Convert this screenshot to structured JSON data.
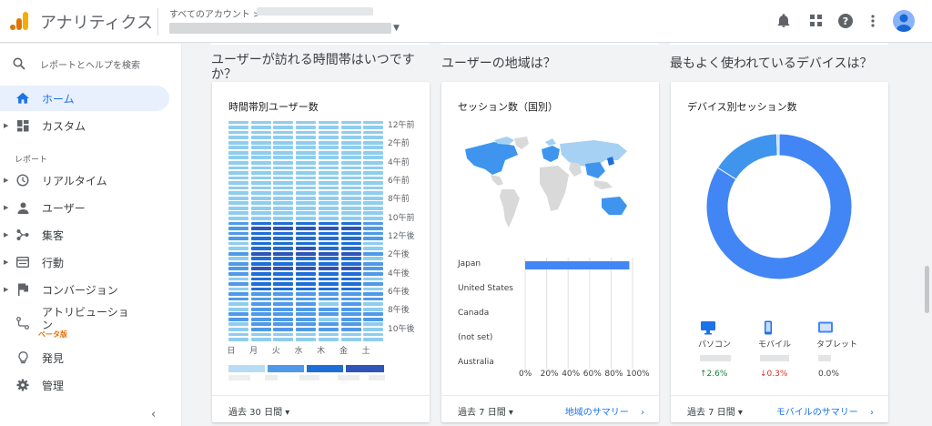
{
  "app": {
    "title": "アナリティクス",
    "breadcrumb": "すべてのアカウント >"
  },
  "colors": {
    "accent": "#1a73e8",
    "orange": "#f9ab00",
    "orange_dark": "#e37400",
    "green": "#188038",
    "red": "#d93025"
  },
  "sidebar": {
    "search_placeholder": "レポートとヘルプを検索",
    "home": "ホーム",
    "custom": "カスタム",
    "section": "レポート",
    "items": [
      {
        "label": "リアルタイム",
        "icon": "clock-icon"
      },
      {
        "label": "ユーザー",
        "icon": "person-icon"
      },
      {
        "label": "集客",
        "icon": "acquisition-icon"
      },
      {
        "label": "行動",
        "icon": "behavior-icon"
      },
      {
        "label": "コンバージョン",
        "icon": "flag-icon"
      }
    ],
    "attribution_line1": "アトリビューショ",
    "attribution_line2": "ン",
    "beta": "ベータ版",
    "discover": "発見",
    "admin": "管理"
  },
  "columns": {
    "time_title": "ユーザーが訪れる時間帯はいつです か？",
    "geo_title": "ユーザーの地域は？",
    "device_title": "最もよく使われているデバイスは？"
  },
  "time_card": {
    "title": "時間帯別ユーザー数",
    "hours": [
      "12午前",
      "2午前",
      "4午前",
      "6午前",
      "8午前",
      "10午前",
      "12午後",
      "2午後",
      "4午後",
      "6午後",
      "8午後",
      "10午後"
    ],
    "days": [
      "日",
      "月",
      "火",
      "水",
      "木",
      "金",
      "土"
    ],
    "period": "過去 30 日間",
    "levels": [
      [
        1,
        1,
        1,
        1,
        1,
        1,
        1
      ],
      [
        1,
        1,
        1,
        1,
        1,
        1,
        1
      ],
      [
        1,
        1,
        1,
        1,
        1,
        1,
        1
      ],
      [
        1,
        1,
        1,
        1,
        1,
        1,
        1
      ],
      [
        1,
        1,
        1,
        1,
        1,
        1,
        1
      ],
      [
        1,
        1,
        1,
        1,
        1,
        1,
        1
      ],
      [
        1,
        1,
        1,
        1,
        1,
        1,
        1
      ],
      [
        1,
        1,
        1,
        1,
        1,
        1,
        1
      ],
      [
        1,
        1,
        1,
        1,
        1,
        1,
        1
      ],
      [
        1,
        1,
        1,
        1,
        1,
        1,
        1
      ],
      [
        1,
        1,
        1,
        1,
        1,
        1,
        1
      ],
      [
        1,
        1,
        1,
        1,
        1,
        1,
        1
      ],
      [
        1,
        1,
        1,
        1,
        1,
        1,
        1
      ],
      [
        1,
        1,
        1,
        1,
        1,
        1,
        1
      ],
      [
        1,
        1,
        1,
        1,
        1,
        1,
        1
      ],
      [
        1,
        1,
        1,
        1,
        1,
        1,
        1
      ],
      [
        1,
        1,
        1,
        1,
        1,
        1,
        1
      ],
      [
        1,
        1,
        1,
        1,
        1,
        1,
        1
      ],
      [
        1,
        1,
        1,
        1,
        1,
        1,
        1
      ],
      [
        1,
        1,
        1,
        1,
        1,
        1,
        1
      ],
      [
        2,
        3,
        3,
        3,
        3,
        3,
        2
      ],
      [
        2,
        4,
        4,
        4,
        4,
        4,
        2
      ],
      [
        2,
        3,
        3,
        3,
        3,
        3,
        2
      ],
      [
        2,
        3,
        3,
        3,
        3,
        3,
        2
      ],
      [
        1,
        3,
        3,
        3,
        3,
        3,
        1
      ],
      [
        1,
        3,
        3,
        4,
        3,
        3,
        1
      ],
      [
        2,
        4,
        4,
        4,
        4,
        4,
        2
      ],
      [
        1,
        3,
        3,
        3,
        3,
        3,
        1
      ],
      [
        2,
        3,
        3,
        3,
        3,
        3,
        2
      ],
      [
        2,
        4,
        4,
        4,
        4,
        4,
        2
      ],
      [
        2,
        3,
        3,
        3,
        3,
        3,
        2
      ],
      [
        1,
        3,
        3,
        3,
        3,
        3,
        1
      ],
      [
        2,
        3,
        3,
        3,
        3,
        3,
        2
      ],
      [
        1,
        3,
        3,
        3,
        3,
        3,
        1
      ],
      [
        2,
        2,
        2,
        2,
        2,
        2,
        2
      ],
      [
        2,
        2,
        2,
        2,
        2,
        2,
        2
      ],
      [
        1,
        2,
        2,
        2,
        1,
        2,
        1
      ],
      [
        1,
        2,
        2,
        2,
        2,
        2,
        1
      ],
      [
        2,
        2,
        2,
        2,
        2,
        2,
        2
      ],
      [
        2,
        2,
        2,
        2,
        1,
        2,
        2
      ],
      [
        1,
        2,
        2,
        2,
        2,
        2,
        1
      ],
      [
        1,
        2,
        2,
        2,
        2,
        2,
        1
      ],
      [
        1,
        1,
        1,
        1,
        1,
        1,
        1
      ],
      [
        1,
        1,
        1,
        1,
        1,
        1,
        1
      ]
    ],
    "scale": [
      "#b8dcf5",
      "#8fcdee",
      "#4f9ae8",
      "#1f6ed8",
      "#2f55b8"
    ]
  },
  "geo_card": {
    "title": "セッション数（国別）",
    "period": "過去 7 日間",
    "link": "地域のサマリー",
    "chart_data": {
      "type": "bar",
      "categories": [
        "Japan",
        "United States",
        "Canada",
        "(not set)",
        "Australia"
      ],
      "values": [
        97,
        0,
        0,
        0,
        0
      ],
      "xlim": [
        0,
        100
      ],
      "ticks": [
        "0%",
        "20%",
        "40%",
        "60%",
        "80%",
        "100%"
      ]
    }
  },
  "device_card": {
    "title": "デバイス別セッション数",
    "period": "過去 7 日間",
    "link": "モバイルのサマリー",
    "chart_data": {
      "type": "pie",
      "categories": [
        "パソコン",
        "モバイル",
        "タブレット"
      ],
      "values": [
        84,
        15.5,
        0.5
      ],
      "colors": [
        "#4285f4",
        "#3f95ee",
        "#a6d1f3"
      ]
    },
    "changes": [
      "2.6%",
      "0.3%",
      "0.0%"
    ],
    "change_dirs": [
      "up",
      "down",
      "none"
    ]
  }
}
